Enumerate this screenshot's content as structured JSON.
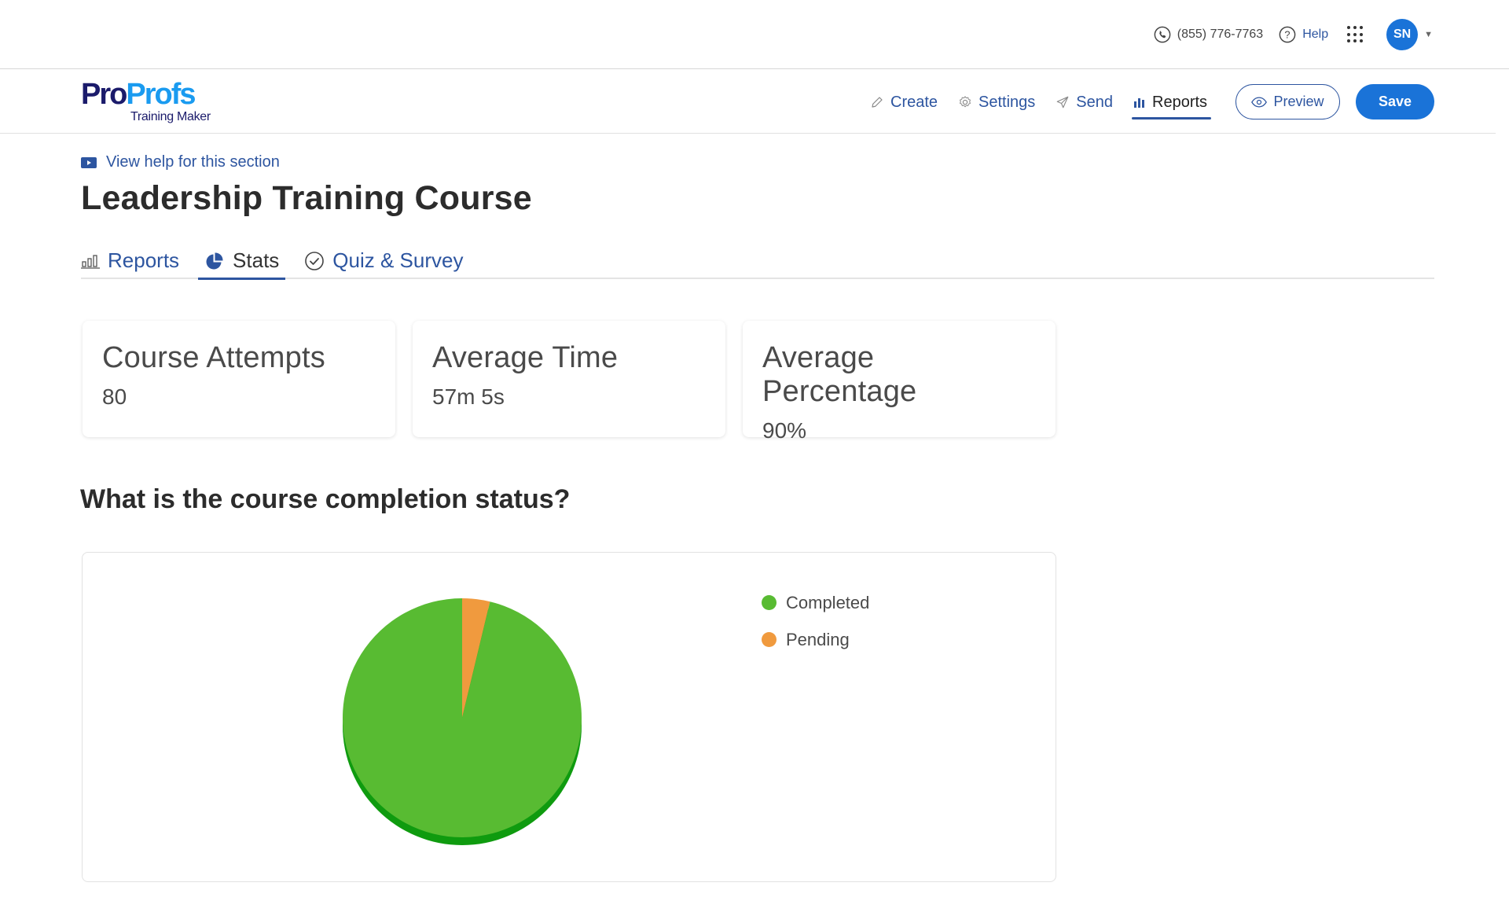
{
  "topbar": {
    "phone": "(855) 776-7763",
    "help_label": "Help",
    "avatar_initials": "SN",
    "accent": "#1a73d8"
  },
  "logo": {
    "part1": "Pro",
    "part2": "Profs",
    "subtitle": "Training Maker"
  },
  "nav": {
    "items": [
      {
        "label": "Create",
        "icon": "pencil-icon"
      },
      {
        "label": "Settings",
        "icon": "gear-icon"
      },
      {
        "label": "Send",
        "icon": "paper-plane-icon"
      },
      {
        "label": "Reports",
        "icon": "bar-chart-icon",
        "active": true
      }
    ],
    "preview_label": "Preview",
    "save_label": "Save"
  },
  "page": {
    "help_link": "View help for this section",
    "title": "Leadership Training Course",
    "tabs": [
      {
        "label": "Reports",
        "icon": "bar-chart-icon"
      },
      {
        "label": "Stats",
        "icon": "pie-chart-icon",
        "active": true
      },
      {
        "label": "Quiz & Survey",
        "icon": "check-circle-icon"
      }
    ]
  },
  "stats": [
    {
      "label": "Course Attempts",
      "value": "80"
    },
    {
      "label": "Average Time",
      "value": "57m 5s"
    },
    {
      "label": "Average Percentage",
      "value": "90%"
    }
  ],
  "section_question": "What is the course completion status?",
  "chart_data": {
    "type": "pie",
    "title": "What is the course completion status?",
    "categories": [
      "Completed",
      "Pending"
    ],
    "values": [
      77,
      3
    ],
    "colors": [
      "#58bb32",
      "#f09a3e"
    ],
    "shadow_color": "#0f9b0f",
    "legend": "right"
  }
}
